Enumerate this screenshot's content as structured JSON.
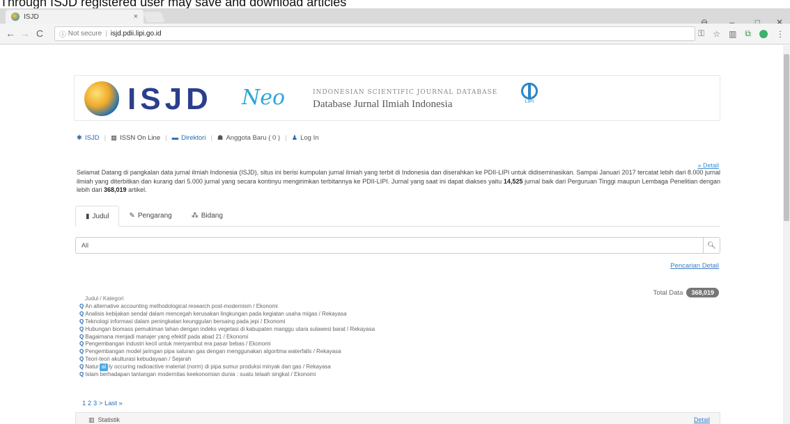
{
  "caption": "Through ISJD registered user may save and download articles",
  "browser": {
    "tab_title": "ISJD",
    "tab_close": "×",
    "url_security": "Not secure",
    "url_host": "isjd.pdii.lipi.go.id",
    "win_controls": {
      "minimize": "–",
      "maximize": "□",
      "close": "✕"
    }
  },
  "logo": {
    "main": "ISJD",
    "suffix": "Neo",
    "subtitle_en": "INDONESIAN SCIENTIFIC JOURNAL DATABASE",
    "subtitle_id": "Database Jurnal Ilmiah Indonesia",
    "lipi_label": "LIPI"
  },
  "topnav": {
    "items": [
      "ISJD",
      "ISSN On Line",
      "Direktori",
      "Anggota Baru ( 0 )",
      "Log In"
    ]
  },
  "detail_link": "» Detail",
  "intro": {
    "text_1": "Selamat Datang di pangkalan data jurnal ilmiah Indonesia (ISJD), situs ini berisi kumpulan jurnal ilmiah yang terbit di Indonesia dan diserahkan ke PDII-LIPI untuk didiseminasikan. Sampai Januari 2017 tercatat lebih dari 8.000 jurnal ilmiah yang diterbitkan dan kurang dari 5.000 jurnal yang secara kontinyu mengirimkan terbitannya ke PDII-LIPI. Jurnal yang saat ini dapat diakses yaitu ",
    "journals": "14,525",
    "text_2": " jurnal baik dari Perguruan Tinggi maupun Lembaga Penelitian dengan lebih dari ",
    "articles": "368,019",
    "text_3": " artikel."
  },
  "tabs": [
    "Judul",
    "Pengarang",
    "Bidang"
  ],
  "search": {
    "value": "All"
  },
  "advanced_search": "Pencarian Detail",
  "total": {
    "label": "Total Data",
    "count": "368,019"
  },
  "results": {
    "header": "Judul / Kategori",
    "items": [
      "An alternative accounting methodological research post-modernism / Ekonomi",
      "Analisis kebijakan sendal dalam mencegah kerusakan lingkungan pada kegiatan usaha migas / Rekayasa",
      "Teknologi informasi dalam peningkatan keunggulan bersaing pada jepi / Ekonomi",
      "Hubungan biomass pemukiman lahan dengan indeks vegetasi di kabupaten manggu utara sulawesi barat / Rekayasa",
      "Bagaimana menjadi manajer yang efektif pada abad 21 / Ekonomi",
      "Pengembangan industri kecil untuk menyambut era pasar bebas / Ekonomi",
      "Pengembangan model jaringan pipa saluran gas dengan menggunakan algoritma waterfalls / Rekayasa",
      "Teori-teori akulturasi kebudayaan / Sejarah",
      "ly occuring radioactive material (norm) di pipa sumur produksi minyak dan gas / Rekayasa",
      "Islam berhadapan tantangan modernitas keekonomian dunia : suatu telaah singkat / Ekonomi"
    ],
    "highlight_prefix": "Natur",
    "highlight_word": "al"
  },
  "pager": "1 2 3 > Last »",
  "stats": {
    "label": "Statistik",
    "detail": "Detail"
  }
}
